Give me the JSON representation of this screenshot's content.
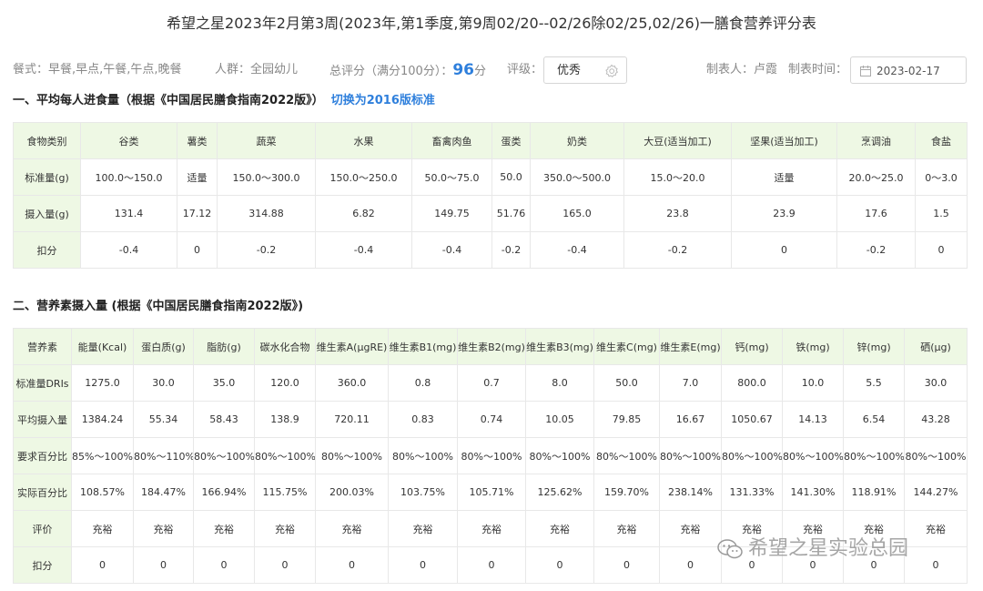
{
  "title": "希望之星2023年2月第3周(2023年,第1季度,第9周02/20--02/26除02/25,02/26)一膳食营养评分表",
  "info": {
    "meals": "餐式：早餐,早点,午餐,午点,晚餐",
    "crowd": "人群：全园幼儿",
    "score_label": "总评分（满分100分）：",
    "score_value": "96",
    "score_unit": "分",
    "grade_label": "评级：",
    "grade_value": "优秀",
    "maker": "制表人：卢霞",
    "date_label": "制表时间：",
    "date_value": "2023-02-17"
  },
  "section1": {
    "title": "一、平均每人进食量（根据《中国居民膳食指南2022版》）",
    "switch": "切换为2016版标准",
    "headers": [
      "食物类别",
      "谷类",
      "薯类",
      "蔬菜",
      "水果",
      "畜禽肉鱼",
      "蛋类",
      "奶类",
      "大豆(适当加工)",
      "坚果(适当加工)",
      "烹调油",
      "食盐"
    ],
    "rows": [
      [
        "标准量(g)",
        "100.0～150.0",
        "适量",
        "150.0～300.0",
        "150.0～250.0",
        "50.0～75.0",
        "50.0",
        "350.0～500.0",
        "15.0～20.0",
        "适量",
        "20.0～25.0",
        "0～3.0"
      ],
      [
        "摄入量(g)",
        "131.4",
        "17.12",
        "314.88",
        "6.82",
        "149.75",
        "51.76",
        "165.0",
        "23.8",
        "23.9",
        "17.6",
        "1.5"
      ],
      [
        "扣分",
        "-0.4",
        "0",
        "-0.2",
        "-0.4",
        "-0.4",
        "-0.2",
        "-0.4",
        "-0.2",
        "0",
        "-0.2",
        "0"
      ]
    ]
  },
  "section2": {
    "title": "二、营养素摄入量 (根据《中国居民膳食指南2022版》)",
    "headers": [
      "营养素",
      "能量(Kcal)",
      "蛋白质(g)",
      "脂肪(g)",
      "碳水化合物",
      "维生素A(μgRE)",
      "维生素B1(mg)",
      "维生素B2(mg)",
      "维生素B3(mg)",
      "维生素C(mg)",
      "维生素E(mg)",
      "钙(mg)",
      "铁(mg)",
      "锌(mg)",
      "硒(μg)"
    ],
    "rows": [
      [
        "标准量DRIs",
        "1275.0",
        "30.0",
        "35.0",
        "120.0",
        "360.0",
        "0.8",
        "0.7",
        "8.0",
        "50.0",
        "7.0",
        "800.0",
        "10.0",
        "5.5",
        "30.0"
      ],
      [
        "平均摄入量",
        "1384.24",
        "55.34",
        "58.43",
        "138.9",
        "720.11",
        "0.83",
        "0.74",
        "10.05",
        "79.85",
        "16.67",
        "1050.67",
        "14.13",
        "6.54",
        "43.28"
      ],
      [
        "要求百分比",
        "85%～100%",
        "80%～110%",
        "80%～100%",
        "80%～100%",
        "80%～100%",
        "80%～100%",
        "80%～100%",
        "80%～100%",
        "80%～100%",
        "80%～100%",
        "80%～100%",
        "80%～100%",
        "80%～100%",
        "80%～100%"
      ],
      [
        "实际百分比",
        "108.57%",
        "184.47%",
        "166.94%",
        "115.75%",
        "200.03%",
        "103.75%",
        "105.71%",
        "125.62%",
        "159.70%",
        "238.14%",
        "131.33%",
        "141.30%",
        "118.91%",
        "144.27%"
      ],
      [
        "评价",
        "充裕",
        "充裕",
        "充裕",
        "充裕",
        "充裕",
        "充裕",
        "充裕",
        "充裕",
        "充裕",
        "充裕",
        "充裕",
        "充裕",
        "充裕",
        "充裕"
      ],
      [
        "扣分",
        "0",
        "0",
        "0",
        "0",
        "0",
        "0",
        "0",
        "0",
        "0",
        "0",
        "0",
        "0",
        "0",
        "0"
      ]
    ]
  },
  "watermark": "希望之星实验总园",
  "colors": {
    "accent": "#2e7fdc",
    "header_bg": "#eef8e4",
    "border": "#e8e8e8"
  }
}
